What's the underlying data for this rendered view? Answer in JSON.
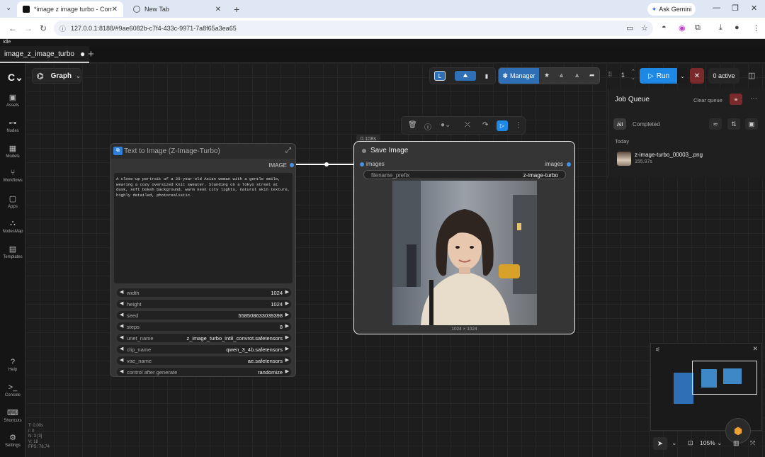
{
  "browser": {
    "active_tab_title": "*image z image turbo - Comfy",
    "inactive_tab_title": "New Tab",
    "gemini_label": "Ask Gemini",
    "url": "127.0.0.1:8188/#9ae6082b-c7f4-433c-9971-7a8f65a3ea65"
  },
  "app": {
    "status_text": "Idle",
    "workflow_tab": "image_z_image_turbo",
    "graph_label": "Graph",
    "sidebar": [
      {
        "label": "Assets",
        "icon": "assets-icon"
      },
      {
        "label": "Nodes",
        "icon": "nodes-icon"
      },
      {
        "label": "Models",
        "icon": "models-icon"
      },
      {
        "label": "Workflows",
        "icon": "workflows-icon"
      },
      {
        "label": "Apps",
        "icon": "apps-icon"
      },
      {
        "label": "NodesMap",
        "icon": "nodesmap-icon"
      },
      {
        "label": "Templates",
        "icon": "templates-icon"
      },
      {
        "label": "Help",
        "icon": "help-icon"
      },
      {
        "label": "Console",
        "icon": "console-icon"
      },
      {
        "label": "Shortcuts",
        "icon": "shortcuts-icon"
      },
      {
        "label": "Settings",
        "icon": "settings-icon"
      }
    ],
    "stats": [
      "T: 0.00s",
      "I: 0",
      "N: 3 [3]",
      "V: 18",
      "FPS: 78.74"
    ],
    "toolbar": {
      "l_badge": "L",
      "manager_label": "Manager",
      "queue_count": "1",
      "run_label": "Run",
      "active_label": "0 active"
    },
    "job_queue": {
      "title": "Job Queue",
      "clear_label": "Clear queue",
      "tab_all": "All",
      "tab_completed": "Completed",
      "today_label": "Today",
      "item_name": "z-image-turbo_00003_.png",
      "item_time": "155.97s"
    },
    "timing_badge": "0.108s",
    "node_t2i": {
      "title": "Text to Image (Z-Image-Turbo)",
      "output_label": "IMAGE",
      "prompt": "A close-up portrait of a 25-year-old Asian woman with a gentle smile, wearing a cozy oversized knit sweater. Standing on a Tokyo street at dusk, soft bokeh background, warm neon city lights, natural skin texture, highly detailed, photorealistic.",
      "widgets": [
        {
          "name": "width",
          "value": "1024"
        },
        {
          "name": "height",
          "value": "1024"
        },
        {
          "name": "seed",
          "value": "558508633039398"
        },
        {
          "name": "steps",
          "value": "8"
        },
        {
          "name": "unet_name",
          "value": "z_image_turbo_int8_convrot.safetensors"
        },
        {
          "name": "clip_name",
          "value": "qwen_3_4b.safetensors"
        },
        {
          "name": "vae_name",
          "value": "ae.safetensors"
        },
        {
          "name": "control after generate",
          "value": "randomize"
        }
      ]
    },
    "node_save": {
      "title": "Save Image",
      "input_label": "images",
      "output_label": "images",
      "prefix_name": "filename_prefix",
      "prefix_value": "z-image-turbo",
      "image_dims": "1024 × 1024"
    },
    "zoom": "105%"
  }
}
